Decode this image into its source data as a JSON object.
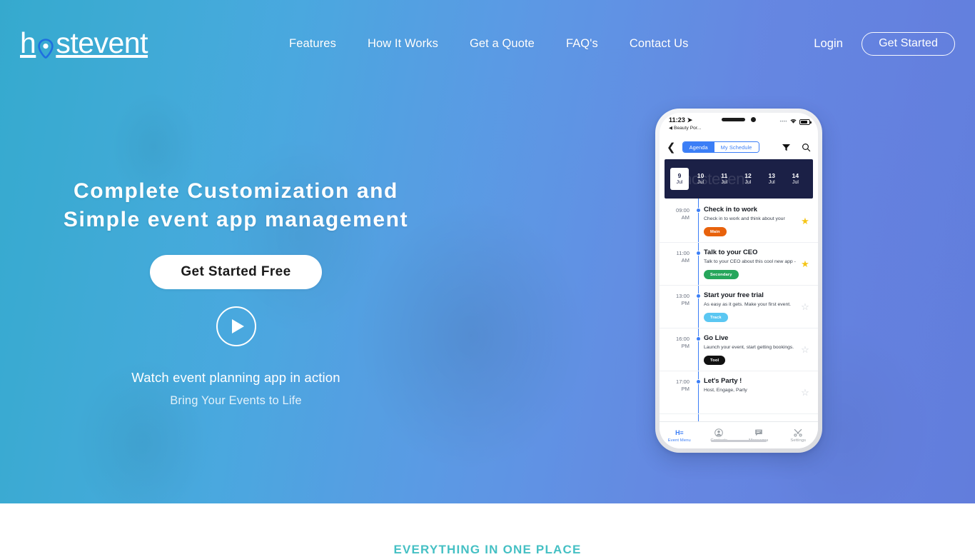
{
  "brand": {
    "logo_text_before": "h",
    "logo_pin_icon": "location-pin-icon",
    "logo_text_after": "stevent",
    "accent_blue": "#1f6fe0",
    "teal": "#45c0c4"
  },
  "nav": {
    "links": [
      {
        "label": "Features"
      },
      {
        "label": "How It Works"
      },
      {
        "label": "Get a Quote"
      },
      {
        "label": "FAQ's"
      },
      {
        "label": "Contact Us"
      }
    ],
    "login_label": "Login",
    "cta_label": "Get Started"
  },
  "hero": {
    "heading_line1": "Complete Customization and",
    "heading_line2": "Simple event app management",
    "cta_label": "Get Started Free",
    "play_icon": "play-icon",
    "watch_text": "Watch event planning app in action",
    "tagline": "Bring Your Events to Life"
  },
  "phone": {
    "status": {
      "time": "11:23",
      "location_icon": "location-arrow-icon",
      "back_app": "◀ Beauty Por...",
      "signal_dots": "••••",
      "wifi_icon": "wifi-icon",
      "battery_icon": "battery-icon"
    },
    "toolbar": {
      "back_icon": "chevron-left-icon",
      "segment_active": "Agenda",
      "segment_inactive": "My Schedule",
      "filter_icon": "filter-icon",
      "search_icon": "search-icon"
    },
    "date_strip": {
      "watermark": "hostevent",
      "days": [
        {
          "num": "9",
          "mon": "Jul",
          "selected": true
        },
        {
          "num": "10",
          "mon": "Jul",
          "selected": false
        },
        {
          "num": "11",
          "mon": "Jul",
          "selected": false
        },
        {
          "num": "12",
          "mon": "Jul",
          "selected": false
        },
        {
          "num": "13",
          "mon": "Jul",
          "selected": false
        },
        {
          "num": "14",
          "mon": "Jul",
          "selected": false
        }
      ]
    },
    "agenda": [
      {
        "time_h": "09:00",
        "time_m": "AM",
        "title": "Check in to work",
        "desc": "Check in to work and think about your",
        "tag": "Main",
        "tag_color": "#e8620c",
        "starred": true
      },
      {
        "time_h": "11:00",
        "time_m": "AM",
        "title": "Talk to your CEO",
        "desc": "Talk to your CEO about this cool new app -",
        "tag": "Secondary",
        "tag_color": "#26a65b",
        "starred": true
      },
      {
        "time_h": "13:00",
        "time_m": "PM",
        "title": "Start your free trial",
        "desc": "As easy as it gets. Make your first event.",
        "tag": "Track",
        "tag_color": "#5bc7f2",
        "starred": false
      },
      {
        "time_h": "16:00",
        "time_m": "PM",
        "title": "Go Live",
        "desc": "Launch your event, start getting bookings.",
        "tag": "Tool",
        "tag_color": "#111111",
        "starred": false
      },
      {
        "time_h": "17:00",
        "time_m": "PM",
        "title": "Let's Party !",
        "desc": "Host, Engage, Party",
        "tag": "",
        "tag_color": "",
        "starred": false
      }
    ],
    "bottom_nav": [
      {
        "label": "Event Menu",
        "icon": "hostevent-logo-icon",
        "active": true
      },
      {
        "label": "Contacts",
        "icon": "person-icon",
        "active": false
      },
      {
        "label": "Messages",
        "icon": "chat-bubble-icon",
        "active": false
      },
      {
        "label": "Settings",
        "icon": "tools-icon",
        "active": false
      }
    ]
  },
  "below_section": {
    "eyebrow": "EVERYTHING IN ONE PLACE"
  }
}
